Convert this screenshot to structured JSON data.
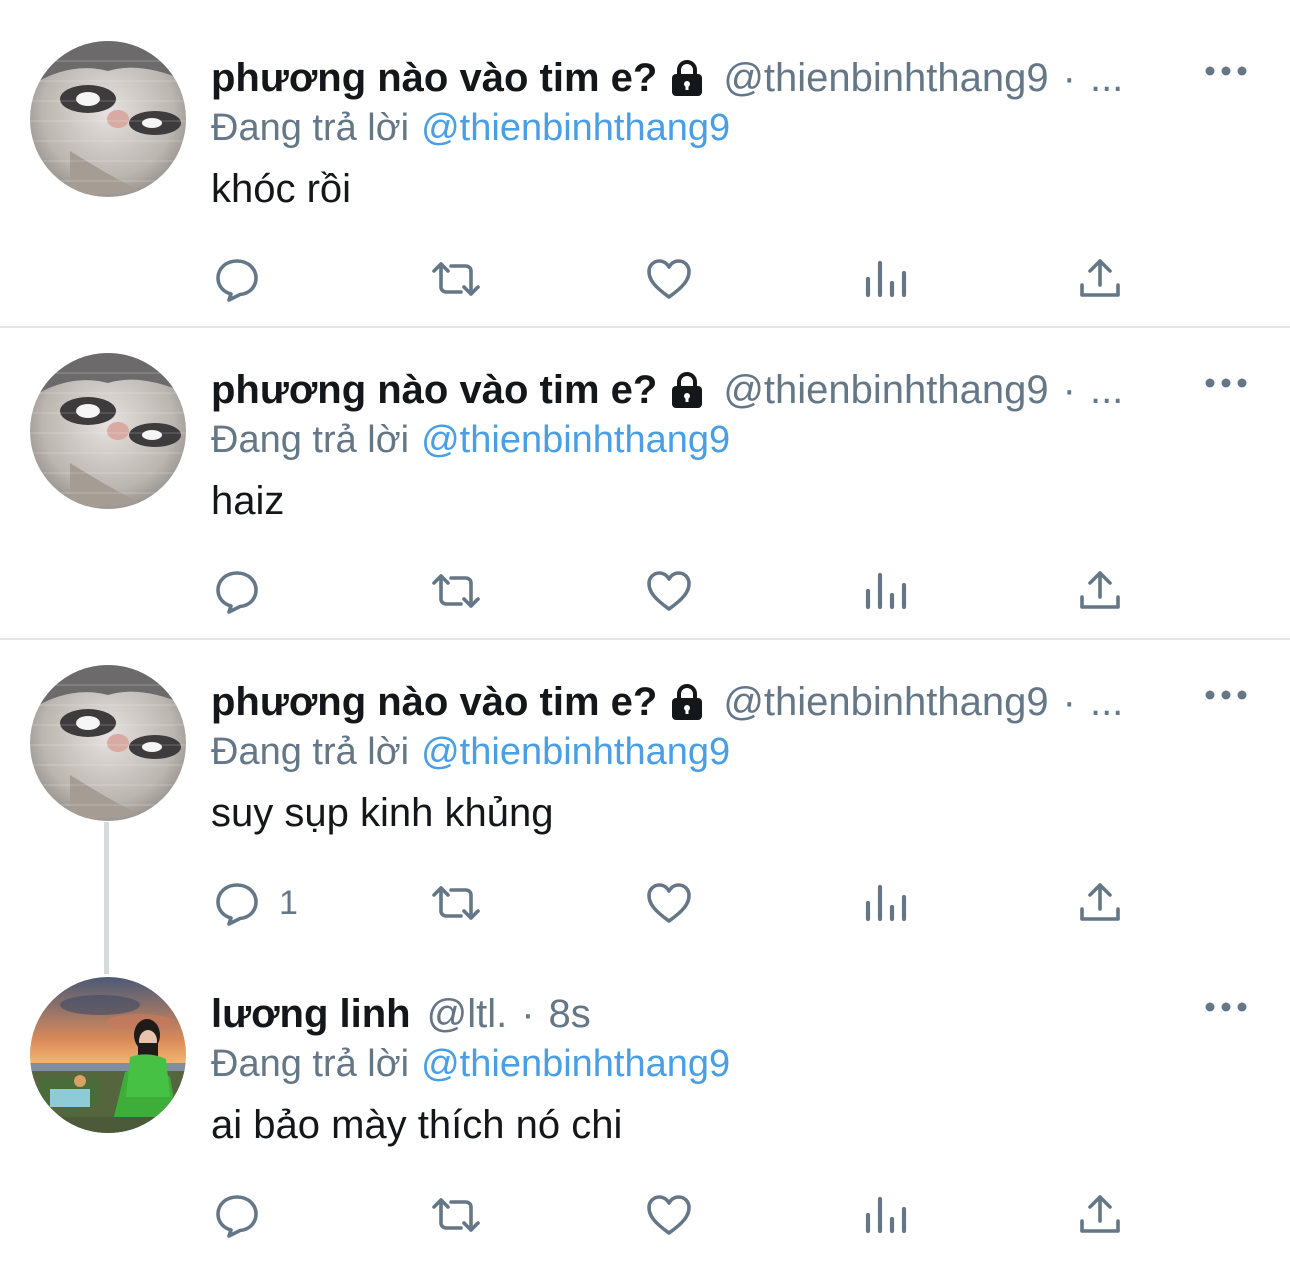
{
  "colors": {
    "text_primary": "#14171a",
    "text_secondary": "#657786",
    "link": "#4a9ee3",
    "divider": "#e1e8ed"
  },
  "tweets": [
    {
      "display_name": "phương nào vào tim e?",
      "locked": true,
      "handle": "@thienbinhthang9",
      "separator": "·",
      "time": "...",
      "replying_prefix": "Đang trả lời",
      "replying_to": "@thienbinhthang9",
      "text": "khóc rồi",
      "reply_count": "",
      "avatar": "cat-avatar"
    },
    {
      "display_name": "phương nào vào tim e?",
      "locked": true,
      "handle": "@thienbinhthang9",
      "separator": "·",
      "time": "...",
      "replying_prefix": "Đang trả lời",
      "replying_to": "@thienbinhthang9",
      "text": "haiz",
      "reply_count": "",
      "avatar": "cat-avatar"
    },
    {
      "display_name": "phương nào vào tim e?",
      "locked": true,
      "handle": "@thienbinhthang9",
      "separator": "·",
      "time": "...",
      "replying_prefix": "Đang trả lời",
      "replying_to": "@thienbinhthang9",
      "text": "suy sụp kinh khủng",
      "reply_count": "1",
      "avatar": "cat-avatar"
    },
    {
      "display_name": "lương linh",
      "locked": false,
      "handle": "@ltl.",
      "separator": "·",
      "time": "8s",
      "replying_prefix": "Đang trả lời",
      "replying_to": "@thienbinhthang9",
      "text": "ai bảo mày thích nó chi",
      "reply_count": "",
      "avatar": "sunset-photo-avatar"
    }
  ],
  "action_icons": [
    "reply-icon",
    "retweet-icon",
    "like-icon",
    "views-icon",
    "share-icon"
  ]
}
